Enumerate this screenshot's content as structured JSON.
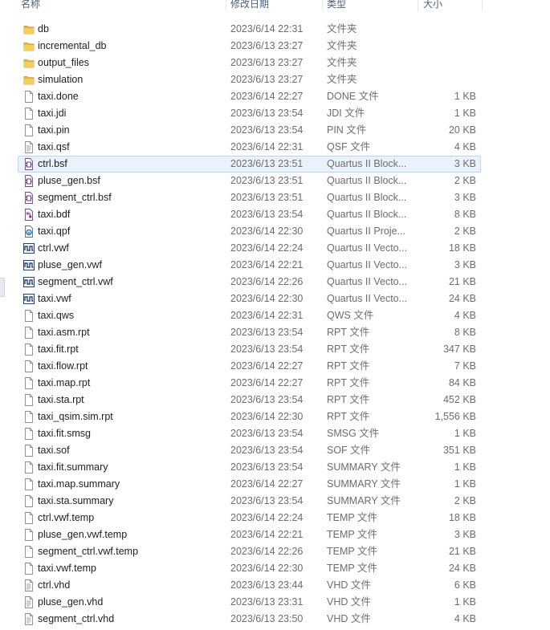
{
  "columns": {
    "name": "名称",
    "date": "修改日期",
    "type": "类型",
    "size": "大小"
  },
  "colors": {
    "folder": "#e8b640",
    "selected_bg": "#eaf3fd",
    "selected_border": "#b8d6f5",
    "header_text": "#4c607a"
  },
  "files": [
    {
      "name": "db",
      "date": "2023/6/14 22:31",
      "type": "文件夹",
      "size": "",
      "icon": "folder-icon"
    },
    {
      "name": "incremental_db",
      "date": "2023/6/13 23:27",
      "type": "文件夹",
      "size": "",
      "icon": "folder-icon"
    },
    {
      "name": "output_files",
      "date": "2023/6/13 23:27",
      "type": "文件夹",
      "size": "",
      "icon": "folder-icon"
    },
    {
      "name": "simulation",
      "date": "2023/6/13 23:27",
      "type": "文件夹",
      "size": "",
      "icon": "folder-icon"
    },
    {
      "name": "taxi.done",
      "date": "2023/6/14 22:27",
      "type": "DONE 文件",
      "size": "1 KB",
      "icon": "blank-file-icon"
    },
    {
      "name": "taxi.jdi",
      "date": "2023/6/13 23:54",
      "type": "JDI 文件",
      "size": "1 KB",
      "icon": "blank-file-icon"
    },
    {
      "name": "taxi.pin",
      "date": "2023/6/13 23:54",
      "type": "PIN 文件",
      "size": "20 KB",
      "icon": "blank-file-icon"
    },
    {
      "name": "taxi.qsf",
      "date": "2023/6/14 22:31",
      "type": "QSF 文件",
      "size": "4 KB",
      "icon": "text-file-icon"
    },
    {
      "name": "ctrl.bsf",
      "date": "2023/6/13 23:51",
      "type": "Quartus II Block...",
      "size": "3 KB",
      "icon": "block-symbol-icon",
      "selected": true
    },
    {
      "name": "pluse_gen.bsf",
      "date": "2023/6/13 23:51",
      "type": "Quartus II Block...",
      "size": "2 KB",
      "icon": "block-symbol-icon"
    },
    {
      "name": "segment_ctrl.bsf",
      "date": "2023/6/13 23:51",
      "type": "Quartus II Block...",
      "size": "3 KB",
      "icon": "block-symbol-icon"
    },
    {
      "name": "taxi.bdf",
      "date": "2023/6/13 23:54",
      "type": "Quartus II Block...",
      "size": "8 KB",
      "icon": "block-diagram-icon"
    },
    {
      "name": "taxi.qpf",
      "date": "2023/6/14 22:30",
      "type": "Quartus II Proje...",
      "size": "2 KB",
      "icon": "quartus-project-icon"
    },
    {
      "name": "ctrl.vwf",
      "date": "2023/6/14 22:24",
      "type": "Quartus II Vecto...",
      "size": "18 KB",
      "icon": "waveform-icon"
    },
    {
      "name": "pluse_gen.vwf",
      "date": "2023/6/14 22:21",
      "type": "Quartus II Vecto...",
      "size": "3 KB",
      "icon": "waveform-icon"
    },
    {
      "name": "segment_ctrl.vwf",
      "date": "2023/6/14 22:26",
      "type": "Quartus II Vecto...",
      "size": "21 KB",
      "icon": "waveform-icon"
    },
    {
      "name": "taxi.vwf",
      "date": "2023/6/14 22:30",
      "type": "Quartus II Vecto...",
      "size": "24 KB",
      "icon": "waveform-icon"
    },
    {
      "name": "taxi.qws",
      "date": "2023/6/14 22:31",
      "type": "QWS 文件",
      "size": "4 KB",
      "icon": "blank-file-icon"
    },
    {
      "name": "taxi.asm.rpt",
      "date": "2023/6/13 23:54",
      "type": "RPT 文件",
      "size": "8 KB",
      "icon": "blank-file-icon"
    },
    {
      "name": "taxi.fit.rpt",
      "date": "2023/6/13 23:54",
      "type": "RPT 文件",
      "size": "347 KB",
      "icon": "blank-file-icon"
    },
    {
      "name": "taxi.flow.rpt",
      "date": "2023/6/14 22:27",
      "type": "RPT 文件",
      "size": "7 KB",
      "icon": "blank-file-icon"
    },
    {
      "name": "taxi.map.rpt",
      "date": "2023/6/14 22:27",
      "type": "RPT 文件",
      "size": "84 KB",
      "icon": "blank-file-icon"
    },
    {
      "name": "taxi.sta.rpt",
      "date": "2023/6/13 23:54",
      "type": "RPT 文件",
      "size": "452 KB",
      "icon": "blank-file-icon"
    },
    {
      "name": "taxi_qsim.sim.rpt",
      "date": "2023/6/14 22:30",
      "type": "RPT 文件",
      "size": "1,556 KB",
      "icon": "blank-file-icon"
    },
    {
      "name": "taxi.fit.smsg",
      "date": "2023/6/13 23:54",
      "type": "SMSG 文件",
      "size": "1 KB",
      "icon": "blank-file-icon"
    },
    {
      "name": "taxi.sof",
      "date": "2023/6/13 23:54",
      "type": "SOF 文件",
      "size": "351 KB",
      "icon": "blank-file-icon"
    },
    {
      "name": "taxi.fit.summary",
      "date": "2023/6/13 23:54",
      "type": "SUMMARY 文件",
      "size": "1 KB",
      "icon": "blank-file-icon"
    },
    {
      "name": "taxi.map.summary",
      "date": "2023/6/14 22:27",
      "type": "SUMMARY 文件",
      "size": "1 KB",
      "icon": "blank-file-icon"
    },
    {
      "name": "taxi.sta.summary",
      "date": "2023/6/13 23:54",
      "type": "SUMMARY 文件",
      "size": "2 KB",
      "icon": "blank-file-icon"
    },
    {
      "name": "ctrl.vwf.temp",
      "date": "2023/6/14 22:24",
      "type": "TEMP 文件",
      "size": "18 KB",
      "icon": "blank-file-icon"
    },
    {
      "name": "pluse_gen.vwf.temp",
      "date": "2023/6/14 22:21",
      "type": "TEMP 文件",
      "size": "3 KB",
      "icon": "blank-file-icon"
    },
    {
      "name": "segment_ctrl.vwf.temp",
      "date": "2023/6/14 22:26",
      "type": "TEMP 文件",
      "size": "21 KB",
      "icon": "blank-file-icon"
    },
    {
      "name": "taxi.vwf.temp",
      "date": "2023/6/14 22:30",
      "type": "TEMP 文件",
      "size": "24 KB",
      "icon": "blank-file-icon"
    },
    {
      "name": "ctrl.vhd",
      "date": "2023/6/13 23:44",
      "type": "VHD 文件",
      "size": "6 KB",
      "icon": "text-file-icon"
    },
    {
      "name": "pluse_gen.vhd",
      "date": "2023/6/13 23:31",
      "type": "VHD 文件",
      "size": "1 KB",
      "icon": "text-file-icon"
    },
    {
      "name": "segment_ctrl.vhd",
      "date": "2023/6/13 23:50",
      "type": "VHD 文件",
      "size": "4 KB",
      "icon": "text-file-icon"
    }
  ]
}
